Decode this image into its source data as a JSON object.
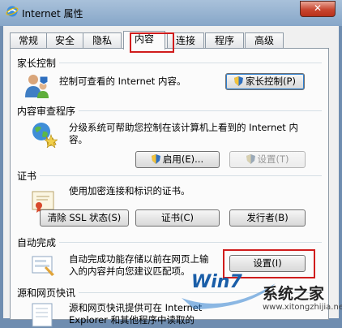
{
  "window": {
    "title": "Internet 属性",
    "close_glyph": "✕"
  },
  "tabs": [
    {
      "label": "常规",
      "active": false
    },
    {
      "label": "安全",
      "active": false
    },
    {
      "label": "隐私",
      "active": false
    },
    {
      "label": "内容",
      "active": true
    },
    {
      "label": "连接",
      "active": false
    },
    {
      "label": "程序",
      "active": false
    },
    {
      "label": "高级",
      "active": false
    }
  ],
  "parental": {
    "header": "家长控制",
    "description": "控制可查看的 Internet 内容。",
    "button": "家长控制(P)",
    "icon": "parental-control-icon"
  },
  "advisor": {
    "header": "内容审查程序",
    "description_line1": "分级系统可帮助您控制在该计算机上看到的 Internet 内",
    "description_line2": "容。",
    "enable_button": "启用(E)...",
    "settings_button": "设置(T)",
    "icon": "globe-icon"
  },
  "certificates": {
    "header": "证书",
    "description": "使用加密连接和标识的证书。",
    "clear_ssl_button": "清除 SSL 状态(S)",
    "certificates_button": "证书(C)",
    "publishers_button": "发行者(B)",
    "icon": "certificate-icon"
  },
  "autocomplete": {
    "header": "自动完成",
    "description_line1": "自动完成功能存储以前在网页上输",
    "description_line2": "入的内容并向您建议匹配项。",
    "settings_button": "设置(I)",
    "icon": "autocomplete-icon"
  },
  "feeds": {
    "header": "源和网页快讯",
    "description_line1": "源和网页快讯提供可在 Internet",
    "description_line2": "Explorer 和其他程序中读取的",
    "icon": "feeds-icon"
  },
  "watermark": {
    "brand": "Win7",
    "site": "系统之家",
    "url": "www.xitongzhijia.net"
  },
  "colors": {
    "highlight_red": "#d01c1c",
    "window_blue": "#86a6c8"
  }
}
